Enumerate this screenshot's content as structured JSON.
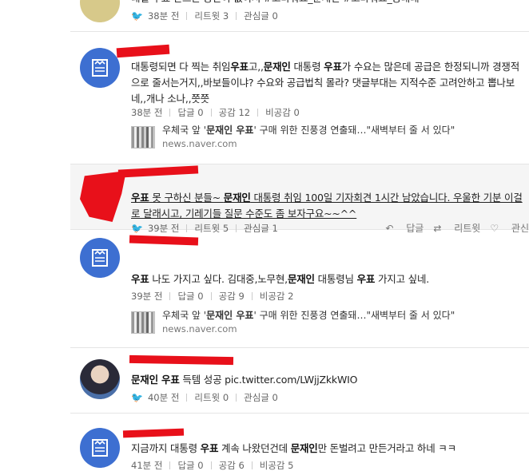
{
  "post0": {
    "body": "대결 우표 만드는 공간이 없이서 #고마워요_문재인 #고마워요_공대대",
    "tweet_time": "38분 전",
    "retweet_label": "리트윗",
    "retweet_count": "3",
    "interest_label": "관심글",
    "interest_count": "0"
  },
  "post1": {
    "body_parts": [
      "대통령되면 다 찍는 취임",
      "우표",
      "고,,",
      "문재인",
      " 대통령 ",
      "우표",
      "가 수요는 많은데 공급은 한정되니까 경쟁적으로 줄서는거지,,바보들이냐? 수요와 공급법칙 몰라? 댓글부대는 지적수준 고려안하고 뽑나보네,,개나 소나,,쯧쯧"
    ],
    "time": "38분 전",
    "reply_label": "답글",
    "reply_count": "0",
    "like_label": "공감",
    "like_count": "12",
    "dislike_label": "비공감",
    "dislike_count": "0",
    "card_title_parts": [
      "우체국 앞 '",
      "문재인 우표",
      "' 구매 위한 진풍경 연출돼…\"새벽부터 줄 서 있다\""
    ],
    "card_source": "news.naver.com"
  },
  "post2": {
    "body_parts": [
      "우표",
      " 못 구하신 분들~ ",
      "문재인",
      " 대통령 취임 100일 기자회견 1시간 남았습니다. 우울한 기분 이걸로 달래시고, 기레기들 질문 수준도 좀 보자구요~~^^"
    ],
    "time": "39분 전",
    "retweet_label": "리트윗",
    "retweet_count": "5",
    "interest_label": "관심글",
    "interest_count": "1",
    "action_reply": "답글",
    "action_retweet": "리트윗",
    "action_interest": "관신"
  },
  "post3": {
    "body_parts": [
      "우표",
      " 나도 가지고 싶다. 김대중,노무현,",
      "문재인",
      " 대통령님 ",
      "우표",
      " 가지고 싶네."
    ],
    "time": "39분 전",
    "reply_label": "답글",
    "reply_count": "0",
    "like_label": "공감",
    "like_count": "9",
    "dislike_label": "비공감",
    "dislike_count": "2",
    "card_title_parts": [
      "우체국 앞 '",
      "문재인 우표",
      "' 구매 위한 진풍경 연출돼…\"새벽부터 줄 서 있다\""
    ],
    "card_source": "news.naver.com"
  },
  "post4": {
    "body_parts": [
      "문재인 우표",
      " 득템 성공 pic.twitter.com/LWjjZkkWIO"
    ],
    "time": "40분 전",
    "retweet_label": "리트윗",
    "retweet_count": "0",
    "interest_label": "관심글",
    "interest_count": "0"
  },
  "post5": {
    "body_parts": [
      "지금까지 대통령 ",
      "우표",
      " 계속 나왔던건데 ",
      "문재인",
      "만 돈벌려고 만든거라고 하네 ㅋㅋ"
    ],
    "time": "41분 전",
    "reply_label": "답글",
    "reply_count": "0",
    "like_label": "공감",
    "like_count": "6",
    "dislike_label": "비공감",
    "dislike_count": "5"
  },
  "colors": {
    "naver_blue": "#3d6fd1",
    "redaction": "#e8101a",
    "twitter": "#1da1f2"
  },
  "icons": {
    "news_avatar": "newspaper-icon",
    "twitter": "twitter-bird-icon"
  }
}
